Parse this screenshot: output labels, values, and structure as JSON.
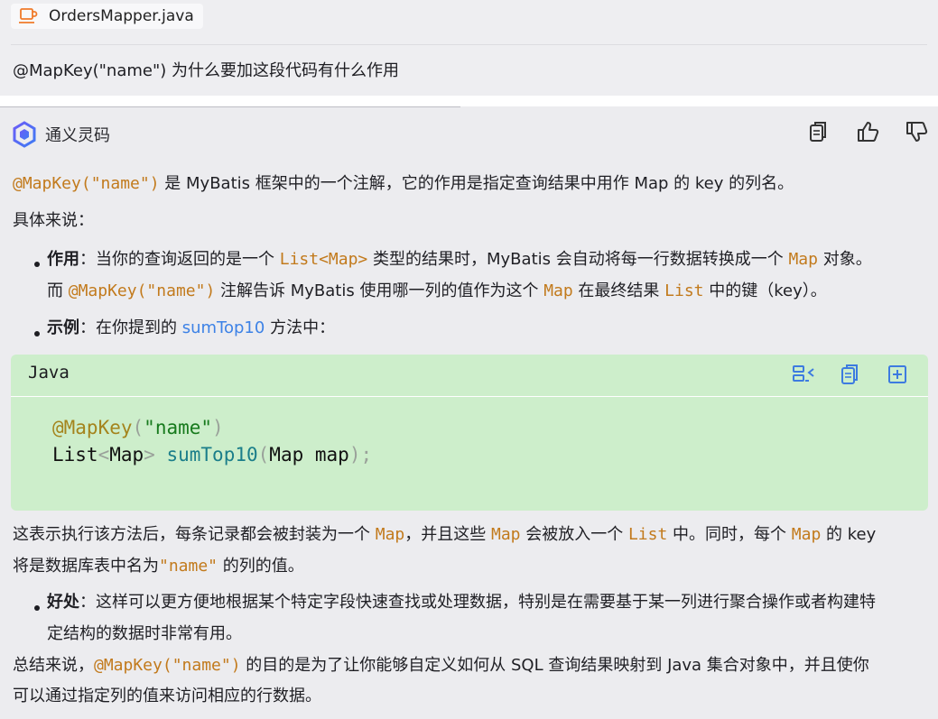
{
  "file_chip": {
    "name": "OrdersMapper.java",
    "icon": "java-cup-icon",
    "accent": "#f07a2a"
  },
  "question": "@MapKey(\"name\") 为什么要加这段代码有什么作用",
  "answer_header": {
    "assistant_name": "通义灵码",
    "actions": [
      "copy-icon",
      "thumbs-up-icon",
      "thumbs-down-icon"
    ]
  },
  "para1": {
    "code": "@MapKey(\"name\")",
    "text": " 是 MyBatis 框架中的一个注解，它的作用是指定查询结果中用作 Map 的 key 的列名。"
  },
  "para2": "具体来说：",
  "bullet1": {
    "label": "作用",
    "colon": "：",
    "t1": "当你的查询返回的是一个 ",
    "c1": "List<Map>",
    "t2": " 类型的结果时，MyBatis 会自动将每一行数据转换成一个 ",
    "c2": "Map",
    "t3": " 对象。",
    "t4": "而 ",
    "c3": "@MapKey(\"name\")",
    "t5": " 注解告诉 MyBatis 使用哪一列的值作为这个 ",
    "c4": "Map",
    "t6": " 在最终结果 ",
    "c5": "List",
    "t7": " 中的键（key）。"
  },
  "bullet2": {
    "label": "示例",
    "colon": "：",
    "t1": "在你提到的 ",
    "c1": "sumTop10",
    "t2": " 方法中："
  },
  "code_block": {
    "language": "Java",
    "bg": "#cdeecb",
    "actions": [
      "insert-code-icon",
      "copy-code-icon",
      "new-file-icon"
    ],
    "line1": {
      "ann": "@MapKey",
      "p1": "(",
      "str": "\"name\"",
      "p2": ")"
    },
    "line2": {
      "t1": "List",
      "p1": "<",
      "t2": "Map",
      "p2": ">",
      "fn": "sumTop10",
      "p3": "(",
      "t3": "Map map",
      "p4": ");"
    }
  },
  "para3": {
    "t1": "这表示执行该方法后，每条记录都会被封装为一个 ",
    "c1": "Map",
    "t2": "，并且这些 ",
    "c2": "Map",
    "t3": " 会被放入一个 ",
    "c3": "List",
    "t4": " 中。同时，每个 ",
    "c4": "Map",
    "t5": " 的 key",
    "t6": "将是数据库表中名为",
    "c5": "\"name\"",
    "t7": " 的列的值。"
  },
  "bullet3": {
    "label": "好处",
    "colon": "：",
    "t1": "这样可以更方便地根据某个特定字段快速查找或处理数据，特别是在需要基于某一列进行聚合操作或者构建特",
    "t2": "定结构的数据时非常有用。"
  },
  "para4": {
    "t1": "总结来说，",
    "c1": "@MapKey(\"name\")",
    "t2": " 的目的是为了让你能够自定义如何从 SQL 查询结果映射到 Java 集合对象中，并且使你",
    "t3": "可以通过指定列的值来访问相应的行数据。"
  }
}
